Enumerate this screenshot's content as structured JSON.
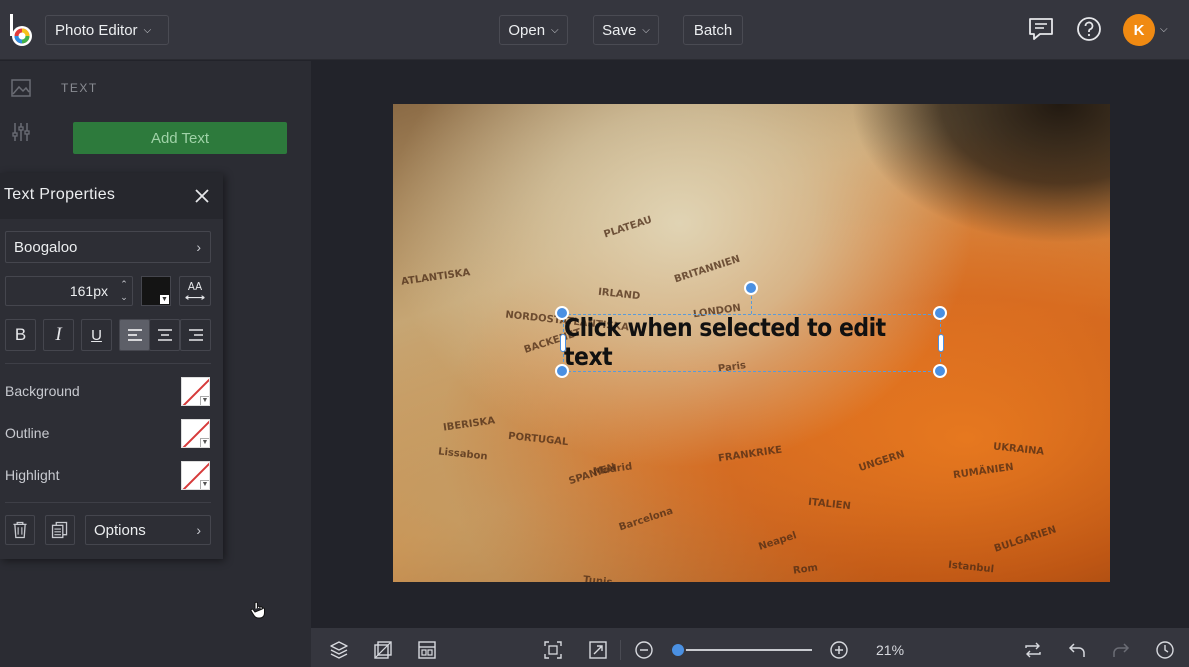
{
  "topbar": {
    "app_name": "Photo Editor",
    "open_label": "Open",
    "save_label": "Save",
    "batch_label": "Batch",
    "avatar_initial": "K",
    "logo_letter": "b",
    "icons": [
      "chat-icon",
      "help-icon"
    ]
  },
  "sidebar": {
    "section_title": "TEXT",
    "add_text_label": "Add Text",
    "rail_icons": [
      "image-icon",
      "adjust-icon"
    ]
  },
  "text_properties": {
    "title": "Text Properties",
    "font": "Boogaloo",
    "size_value": "161",
    "size_unit": "px",
    "text_color": "#141414",
    "aa_label": "AA",
    "format_buttons": [
      "B",
      "I",
      "U"
    ],
    "align_selected": "left",
    "background_label": "Background",
    "outline_label": "Outline",
    "highlight_label": "Highlight",
    "options_label": "Options"
  },
  "canvas": {
    "text_content": "Click when selected to edit text",
    "map_labels": [
      "PLATEAU",
      "ATLANTISKA",
      "IRLAND",
      "BRITANNIEN",
      "LONDON",
      "NORDOSTATLANTISKA",
      "BACKENET",
      "IBERISKA",
      "PORTUGAL",
      "SPANIEN",
      "FRANKRIKE",
      "ITALIEN",
      "UNGERN",
      "RUMÄNIEN",
      "UKRAINA",
      "BULGARIEN",
      "Madrid",
      "Lissabon",
      "Barcelona",
      "Paris",
      "Istanbul",
      "Neapel",
      "Rom",
      "Tunis"
    ]
  },
  "bottombar": {
    "zoom": "21%",
    "zoom_fraction": 0.0
  },
  "colors": {
    "accent": "#4a90e2",
    "add_text_bg": "#2d7a3c",
    "avatar": "#f08a12"
  }
}
